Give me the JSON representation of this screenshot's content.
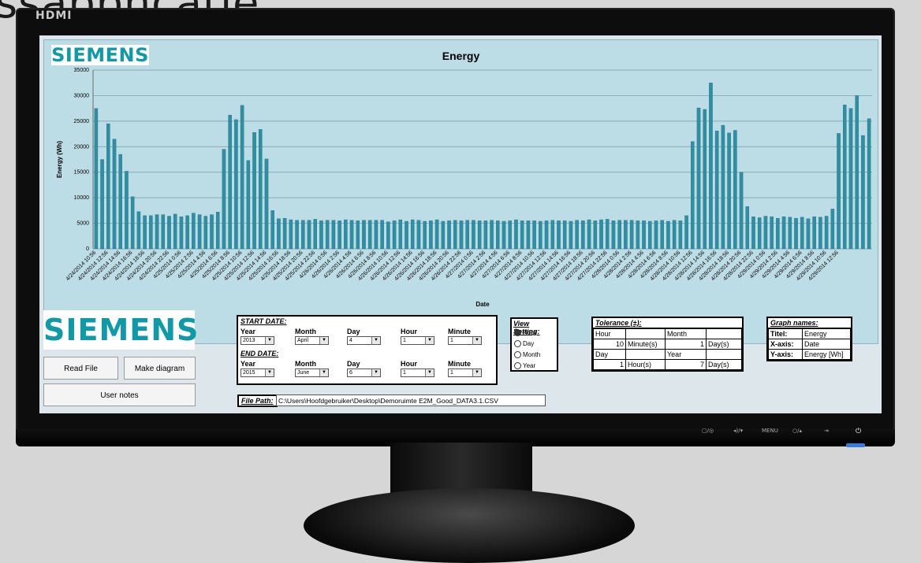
{
  "background_text": "ssappncatie",
  "monitor": {
    "brand": "HDMI",
    "controls": [
      "▢/◎",
      "◂)/▾",
      "MENU",
      "○/▴",
      "⇥",
      "⏻"
    ]
  },
  "top_logo": "SIEMENS",
  "chart": {
    "title": "Energy",
    "xlabel": "Date",
    "ylabel": "Energy (Wh)",
    "y_ticks": [
      "35000",
      "30000",
      "25000",
      "20000",
      "15000",
      "10000",
      "5000",
      "0"
    ]
  },
  "chart_data": {
    "type": "bar",
    "title": "Energy",
    "xlabel": "Date",
    "ylabel": "Energy (Wh)",
    "ylim": [
      0,
      35000
    ],
    "grid": true,
    "categories": [
      "4/24/2014 10:56",
      "4/24/2014 12:56",
      "4/24/2014 14:56",
      "4/24/2014 16:56",
      "4/24/2014 18:56",
      "4/24/2014 20:56",
      "4/24/2014 22:56",
      "4/25/2014 0:56",
      "4/25/2014 2:56",
      "4/25/2014 4:56",
      "4/25/2014 6:56",
      "4/25/2014 8:56",
      "4/25/2014 10:56",
      "4/25/2014 12:56",
      "4/25/2014 14:56",
      "4/25/2014 16:56",
      "4/25/2014 18:56",
      "4/25/2014 20:56",
      "4/25/2014 22:56",
      "4/26/2014 0:56",
      "4/26/2014 2:56",
      "4/26/2014 4:56",
      "4/26/2014 6:56",
      "4/26/2014 8:56",
      "4/26/2014 10:56",
      "4/26/2014 12:56",
      "4/26/2014 14:56",
      "4/26/2014 16:56",
      "4/26/2014 18:56",
      "4/26/2014 20:56",
      "4/26/2014 22:56",
      "4/27/2014 0:56",
      "4/27/2014 2:56",
      "4/27/2014 4:56",
      "4/27/2014 6:56",
      "4/27/2014 8:56",
      "4/27/2014 10:56",
      "4/27/2014 12:56",
      "4/27/2014 14:56",
      "4/27/2014 16:56",
      "4/27/2014 18:56",
      "4/27/2014 20:56",
      "4/27/2014 22:56",
      "4/28/2014 0:56",
      "4/28/2014 2:56",
      "4/28/2014 4:56",
      "4/28/2014 6:56",
      "4/28/2014 8:56",
      "4/28/2014 10:56",
      "4/28/2014 12:56",
      "4/28/2014 14:56",
      "4/28/2014 16:56",
      "4/28/2014 18:56",
      "4/28/2014 20:56",
      "4/28/2014 22:56",
      "4/29/2014 0:56",
      "4/29/2014 2:56",
      "4/29/2014 4:56",
      "4/29/2014 6:56",
      "4/29/2014 8:56",
      "4/29/2014 10:56",
      "4/29/2014 12:56"
    ],
    "values": [
      27500,
      17500,
      24500,
      21500,
      18500,
      15200,
      10200,
      7300,
      6500,
      6500,
      6700,
      6700,
      6400,
      6800,
      6300,
      6500,
      7000,
      6700,
      6400,
      6700,
      7200,
      19500,
      26200,
      25300,
      28100,
      17300,
      22800,
      23400,
      17600,
      7500,
      5900,
      6000,
      5700,
      5600,
      5600,
      5600,
      5800,
      5500,
      5600,
      5600,
      5500,
      5700,
      5600,
      5500,
      5600,
      5600,
      5600,
      5600,
      5300,
      5500,
      5700,
      5400,
      5700,
      5600,
      5400,
      5500,
      5700,
      5400,
      5500,
      5600,
      5500,
      5600,
      5600,
      5500,
      5500,
      5600,
      5500,
      5400,
      5500,
      5700,
      5500,
      5500,
      5500,
      5400,
      5500,
      5600,
      5500,
      5500,
      5400,
      5600,
      5500,
      5700,
      5500,
      5700,
      5800,
      5500,
      5600,
      5600,
      5600,
      5500,
      5500,
      5400,
      5500,
      5600,
      5400,
      5600,
      5500,
      6500,
      21000,
      27600,
      27300,
      32500,
      23100,
      24200,
      22700,
      23200,
      15000,
      8300,
      6300,
      6100,
      6400,
      6300,
      6000,
      6300,
      6200,
      6000,
      6200,
      5900,
      6300,
      6200,
      6400,
      7800,
      22600,
      28200,
      27500,
      30000,
      22200,
      25500
    ]
  },
  "bottom_logo": "SIEMENS",
  "buttons": {
    "read_file": "Read File",
    "make_diagram": "Make diagram",
    "user_notes": "User notes"
  },
  "dates": {
    "start_label": "START DATE:",
    "end_label": "END DATE:",
    "col_labels": [
      "Year",
      "Month",
      "Day",
      "Hour",
      "Minute"
    ],
    "start": {
      "year": "2013",
      "month": "April",
      "day": "4",
      "hour": "1",
      "minute": "1"
    },
    "end": {
      "year": "2015",
      "month": "June",
      "day": "6",
      "hour": "1",
      "minute": "1"
    }
  },
  "view_setting": {
    "title": "View Setting:",
    "options": [
      "Hour",
      "Day",
      "Month",
      "Year"
    ],
    "selected": "Hour"
  },
  "tolerance": {
    "title": "Tolerance (±):",
    "rows": [
      [
        "Hour",
        "",
        "Month",
        ""
      ],
      [
        "10",
        "Minute(s)",
        "1",
        "Day(s)"
      ],
      [
        "Day",
        "",
        "Year",
        ""
      ],
      [
        "1",
        "Hour(s)",
        "7",
        "Day(s)"
      ]
    ]
  },
  "graph_names": {
    "title": "Graph names:",
    "rows": [
      [
        "Titel:",
        "Energy"
      ],
      [
        "X-axis:",
        "Date"
      ],
      [
        "Y-axis:",
        "Energy [Wh]"
      ]
    ]
  },
  "file_path": {
    "label": "File Path:",
    "value": "C:\\Users\\Hoofdgebruiker\\Desktop\\Demoruimte E2M_Good_DATA3.1.CSV"
  }
}
